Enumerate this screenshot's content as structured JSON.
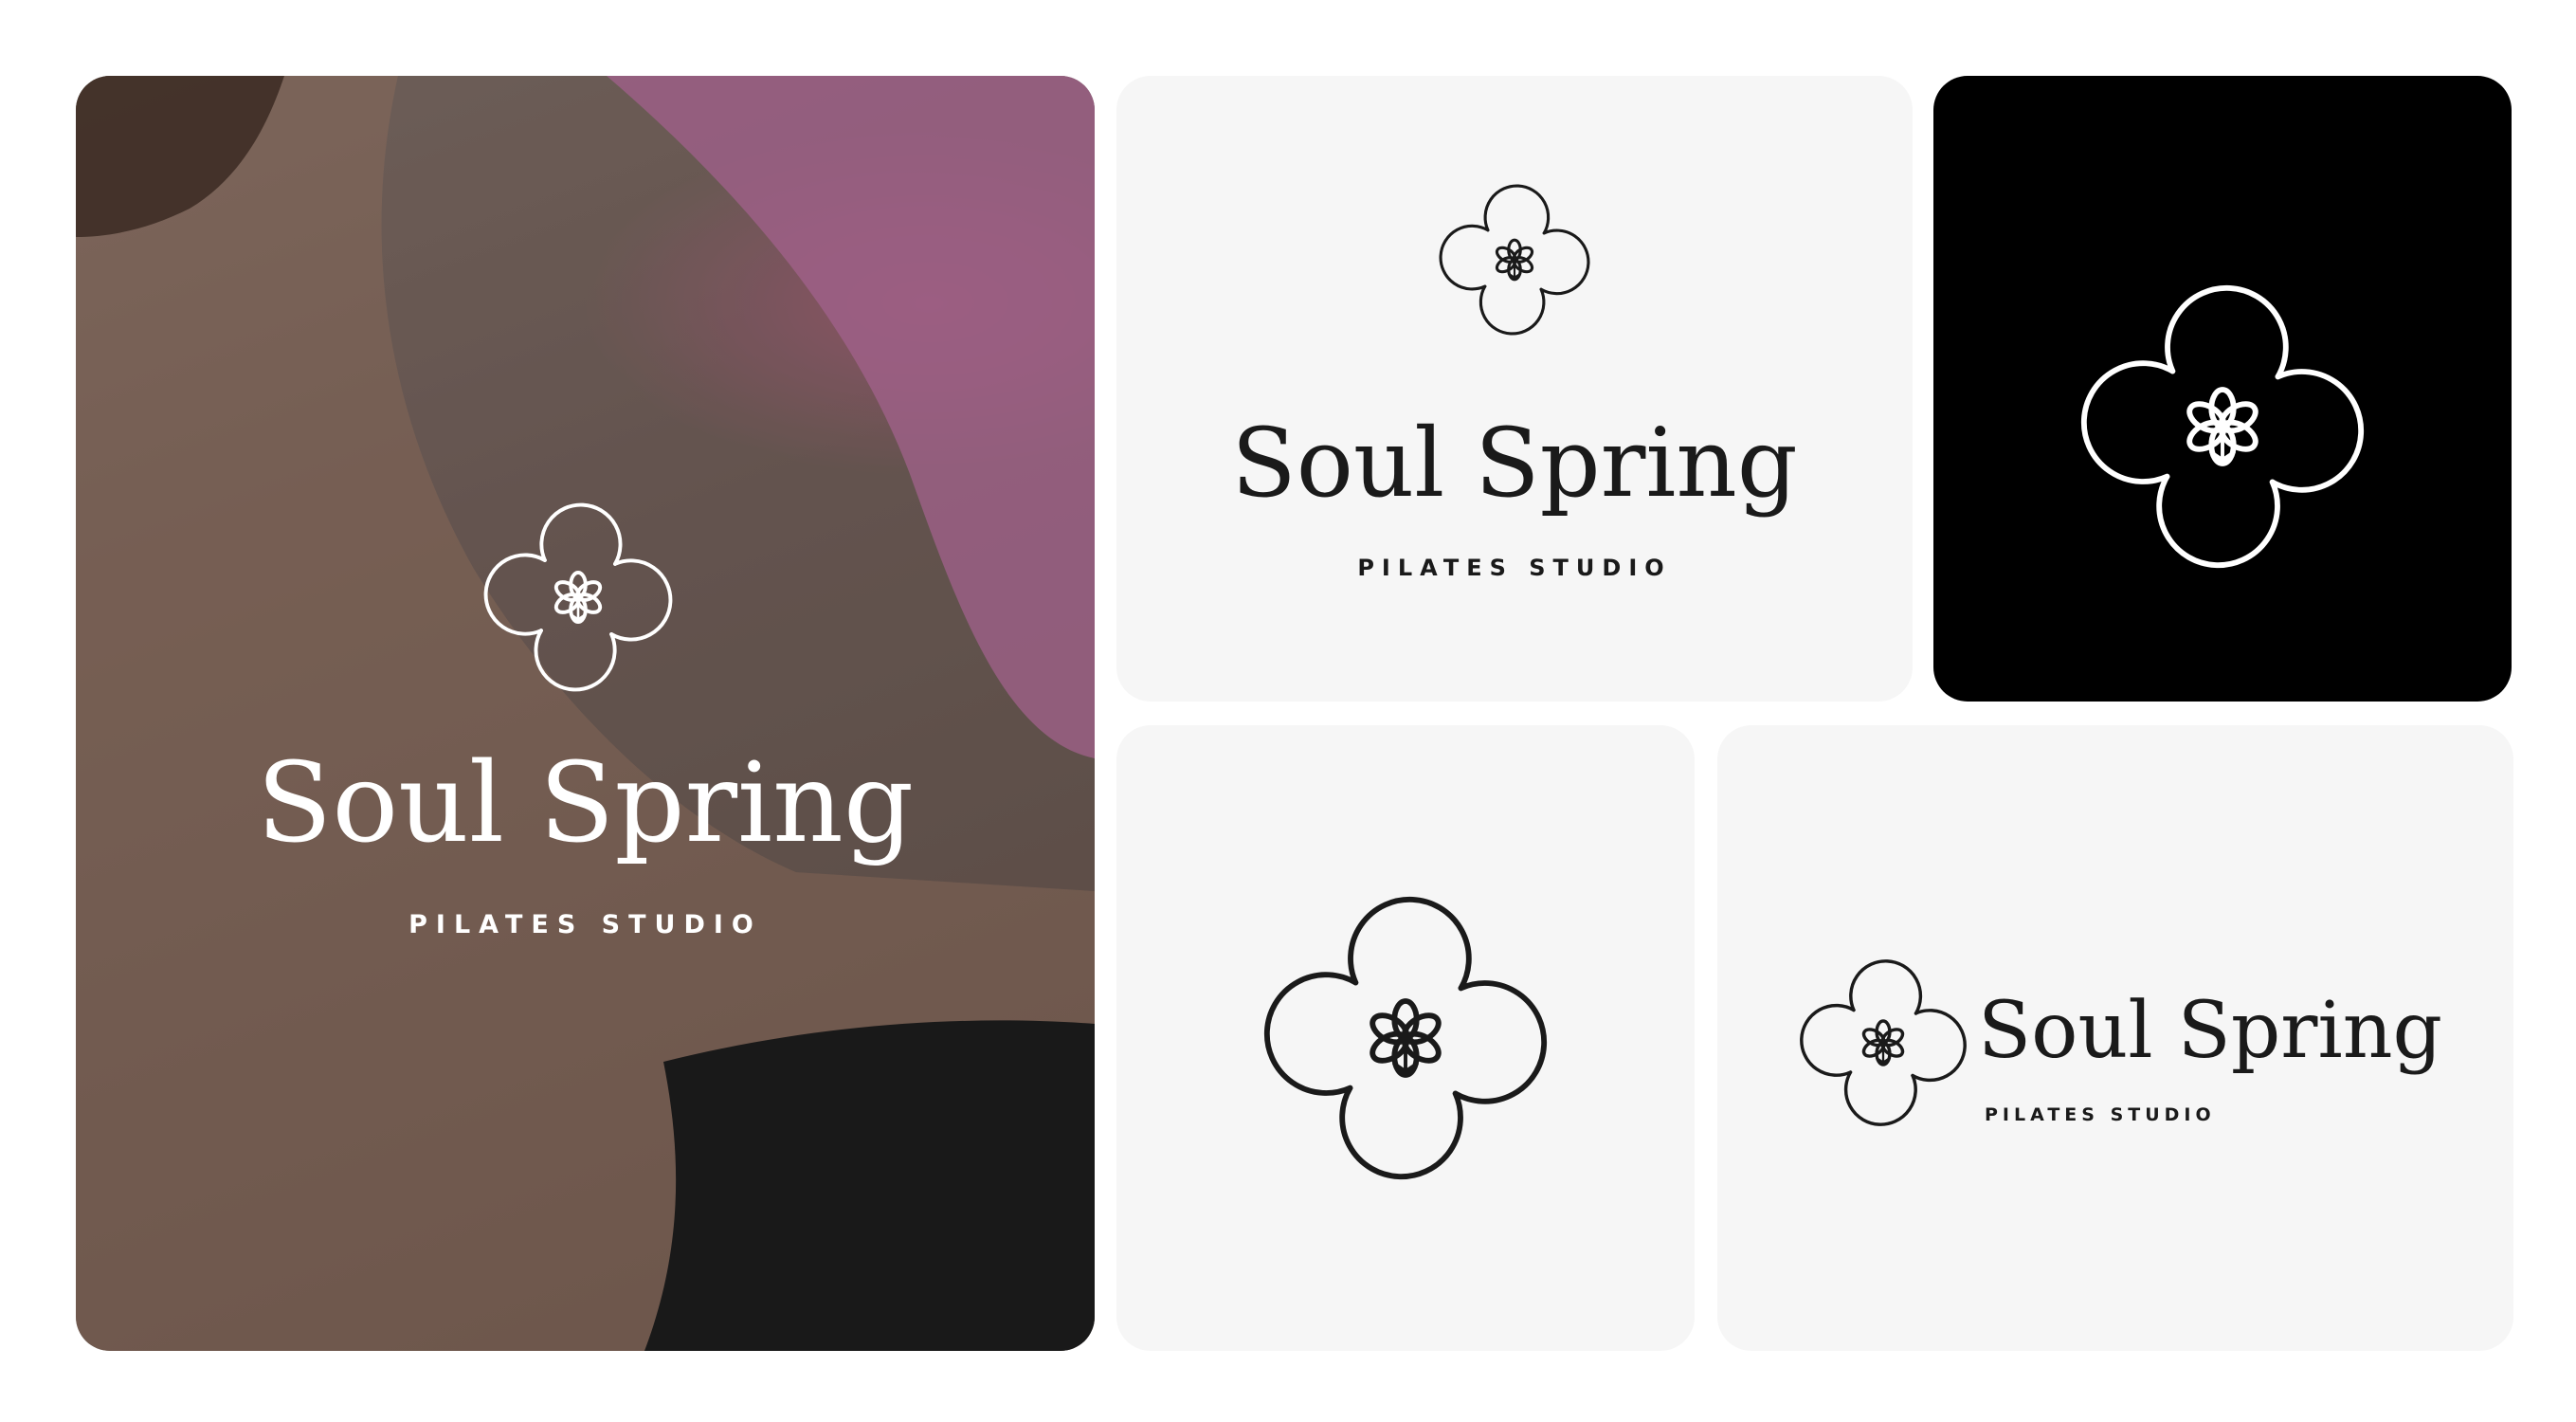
{
  "brand": {
    "name": "Soul Spring",
    "tagline": "PILATES   STUDIO",
    "tagline_compact": "PILATES STUDIO"
  },
  "colors": {
    "ink": "#1a1a1a",
    "light_bg": "#f6f6f6",
    "dark_bg": "#000000",
    "on_photo": "#ffffff",
    "accent_pink": "#b06a98"
  },
  "icons": {
    "logo_mark": "flower-quatrefoil-icon"
  }
}
